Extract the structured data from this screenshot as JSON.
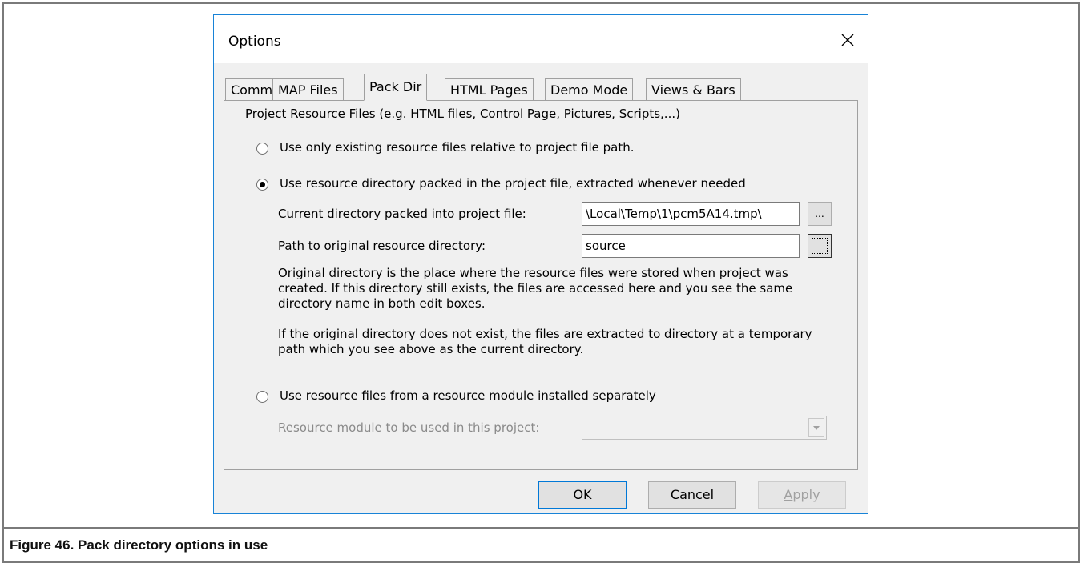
{
  "dialog": {
    "title": "Options",
    "tabs": [
      {
        "label": "Comm",
        "active": false
      },
      {
        "label": "MAP Files",
        "active": false
      },
      {
        "label": "Pack Dir",
        "active": true
      },
      {
        "label": "HTML Pages",
        "active": false
      },
      {
        "label": "Demo Mode",
        "active": false
      },
      {
        "label": "Views & Bars",
        "active": false
      }
    ],
    "group": {
      "legend": "Project Resource Files (e.g. HTML files, Control Page, Pictures, Scripts,...)",
      "radio_existing": "Use only existing resource files relative to project file path.",
      "radio_packed": "Use resource directory packed in the project file, extracted whenever needed",
      "current_dir_label": "Current directory packed into project file:",
      "current_dir_value": "\\Local\\Temp\\1\\pcm5A14.tmp\\",
      "browse_label": "...",
      "original_path_label": "Path to original resource directory:",
      "original_path_value": "source",
      "explanation_1": "Original directory is the place where the resource files were stored when project was created. If this directory still exists, the files are accessed here and you see the same directory name in both edit boxes.",
      "explanation_2": "If the original directory does not exist, the files are extracted to directory at a temporary path which you see above as the current directory.",
      "radio_module": "Use resource files from a resource module installed separately",
      "module_label": "Resource module to be used in this project:",
      "module_value": "",
      "selected_option": "packed"
    },
    "buttons": {
      "ok": "OK",
      "cancel": "Cancel",
      "apply_first": "A",
      "apply_rest": "pply"
    }
  },
  "caption": "Figure 46. Pack directory options in use"
}
